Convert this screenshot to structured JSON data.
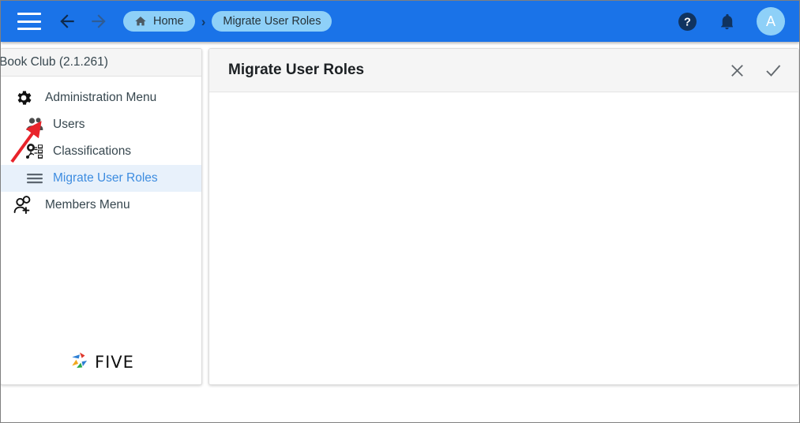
{
  "topbar": {
    "accent_color": "#1a73e8",
    "chip_color": "#8ed0f8",
    "menu_icon": "hamburger-menu-icon",
    "back_icon": "arrow-back-icon",
    "forward_icon": "arrow-forward-icon",
    "breadcrumbs": [
      {
        "label": "Home",
        "icon": "home-icon"
      },
      {
        "label": "Migrate User Roles",
        "icon": ""
      }
    ],
    "separator": "›",
    "help_icon": "help-circle-icon",
    "notification_icon": "bell-icon",
    "avatar_initial": "A"
  },
  "sidebar": {
    "title": "Book Club (2.1.261)",
    "items": [
      {
        "label": "Administration Menu",
        "icon": "gear-icon",
        "level": 0,
        "active": false
      },
      {
        "label": "Users",
        "icon": "users-icon",
        "level": 1,
        "active": false
      },
      {
        "label": "Classifications",
        "icon": "classifications-network-icon",
        "level": 1,
        "active": false
      },
      {
        "label": "Migrate User Roles",
        "icon": "list-lines-icon",
        "level": 1,
        "active": true
      },
      {
        "label": "Members Menu",
        "icon": "add-person-icon",
        "level": 0,
        "active": false
      }
    ],
    "brand": {
      "name": "FIVE",
      "logo_icon": "five-pinwheel-logo",
      "colors": [
        "#2e7fd4",
        "#e03b2f",
        "#f2a81d",
        "#2aa84a"
      ]
    }
  },
  "card": {
    "title": "Migrate User Roles",
    "close_icon": "close-x-icon",
    "confirm_icon": "checkmark-icon",
    "body_text": ""
  },
  "annotation": {
    "arrow_icon": "red-pointer-arrow",
    "color": "#e8232a",
    "points_to": "Users"
  }
}
